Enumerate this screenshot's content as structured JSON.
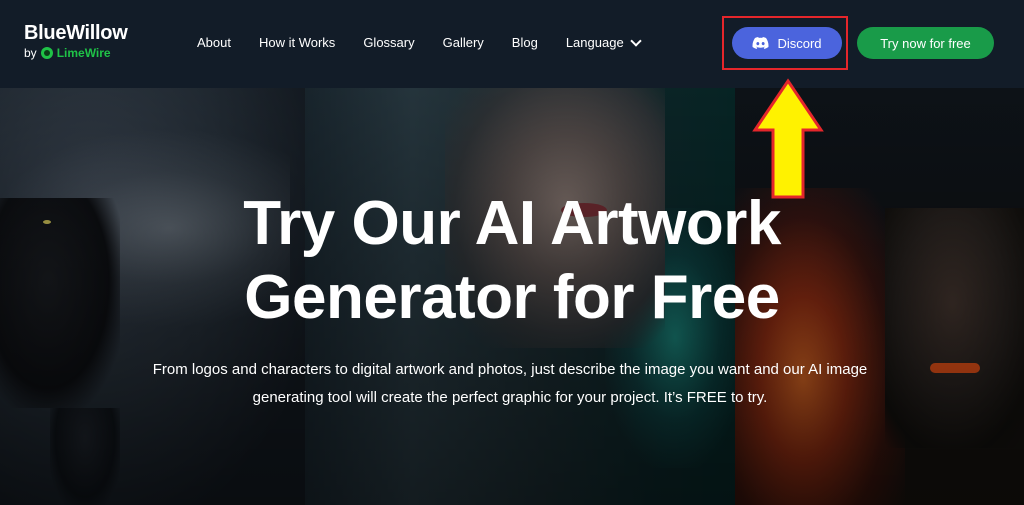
{
  "brand": {
    "name": "BlueWillow",
    "by": "by",
    "partner": "LimeWire"
  },
  "nav": {
    "items": [
      "About",
      "How it Works",
      "Glossary",
      "Gallery",
      "Blog"
    ],
    "language": "Language"
  },
  "buttons": {
    "discord": "Discord",
    "try": "Try now for free"
  },
  "hero": {
    "title_line1": "Try Our AI Artwork",
    "title_line2": "Generator for Free",
    "desc_line1": "From logos and characters to digital artwork and photos,  just describe the image you want and our AI image",
    "desc_line2": "generating tool will create the perfect graphic for your project. It’s FREE to try."
  },
  "colors": {
    "discord_button": "#4b64dd",
    "try_button": "#199b49",
    "highlight_box": "#e5262b",
    "annotation_arrow": "#fff200",
    "limewire_green": "#1fc247"
  },
  "icons": {
    "discord": "discord-icon",
    "language": "chevron-down-icon",
    "partner_logo": "limewire-logo-icon",
    "annotation": "arrow-up-icon"
  }
}
